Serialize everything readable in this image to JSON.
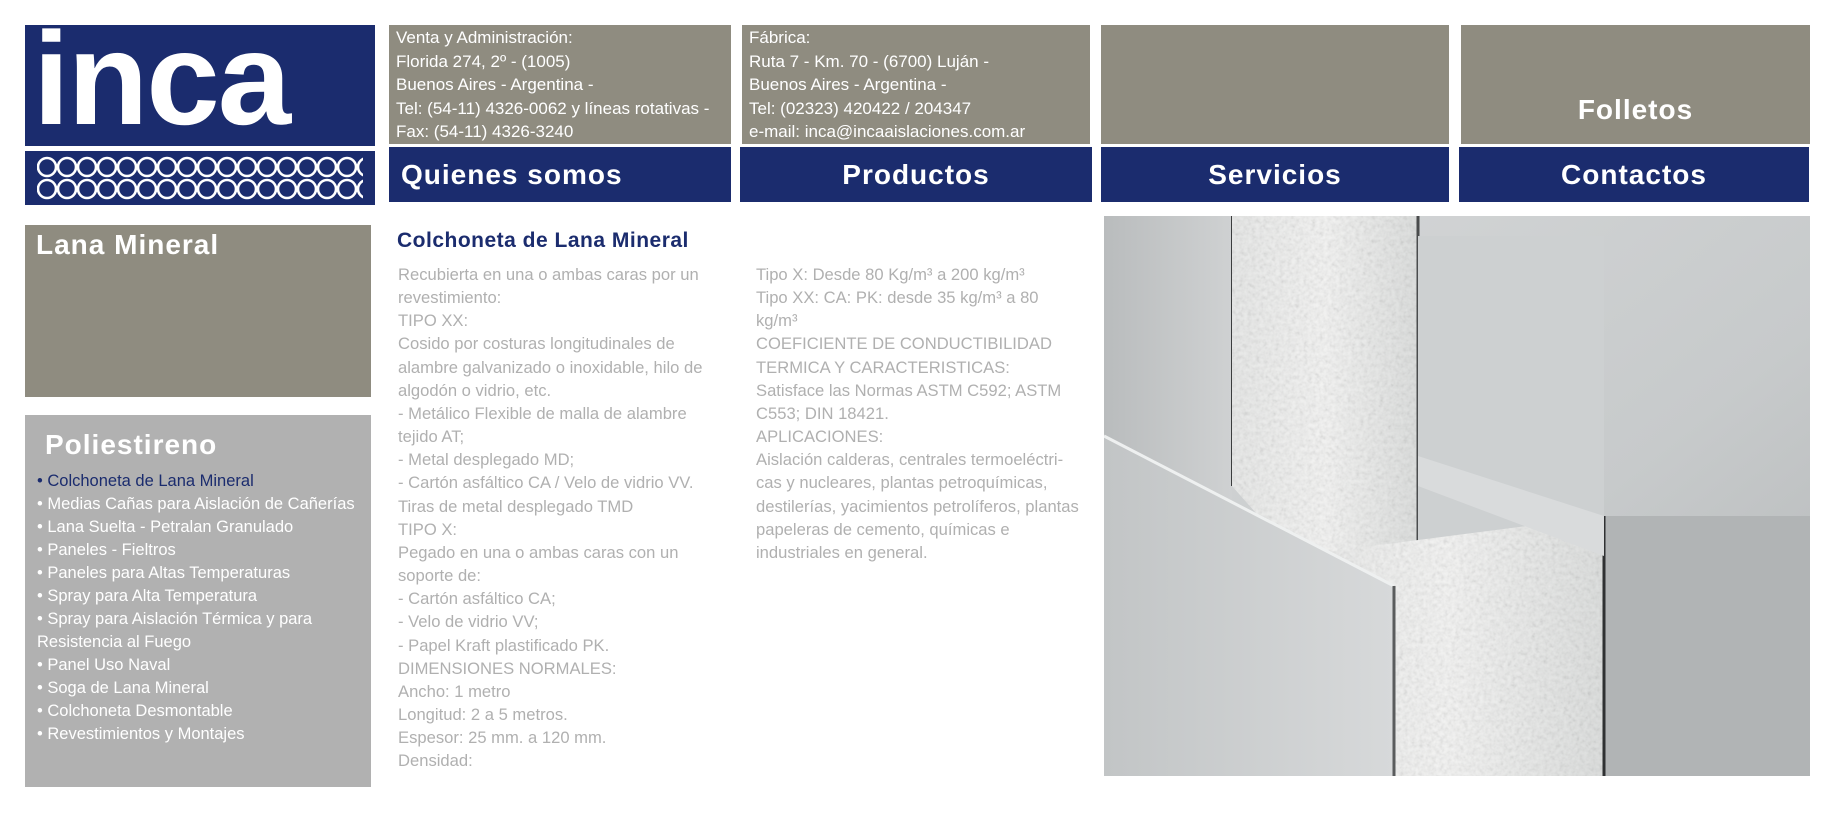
{
  "logo": {
    "text": "inca"
  },
  "header": {
    "venta": {
      "lines": [
        "Venta y Administración:",
        "Florida 274, 2º - (1005)",
        "Buenos Aires - Argentina -",
        "Tel: (54-11) 4326-0062 y líneas rotativas -",
        "Fax: (54-11) 4326-3240"
      ]
    },
    "fabrica": {
      "lines": [
        "Fábrica:",
        "Ruta 7 - Km. 70 - (6700) Luján -",
        "Buenos Aires - Argentina -",
        "Tel: (02323) 420422 / 204347",
        "e-mail: inca@incaaislaciones.com.ar"
      ]
    },
    "folletos_label": "Folletos"
  },
  "nav": {
    "quienes": "Quienes somos",
    "productos": "Productos",
    "servicios": "Servicios",
    "contactos": "Contactos"
  },
  "sidebar": {
    "lana_title": "Lana Mineral",
    "poli_title": "Poliestireno",
    "items": [
      {
        "label": "• Colchoneta de Lana Mineral"
      },
      {
        "label": "• Medias Cañas para Aislación de Cañerías"
      },
      {
        "label": "• Lana Suelta - Petralan Granulado"
      },
      {
        "label": "• Paneles - Fieltros"
      },
      {
        "label": "• Paneles para Altas Temperaturas"
      },
      {
        "label": "• Spray para Alta Temperatura"
      },
      {
        "label": "• Spray para Aislación Térmica y para"
      },
      {
        "label": "Resistencia al Fuego"
      },
      {
        "label": "• Panel Uso Naval"
      },
      {
        "label": "• Soga de Lana Mineral"
      },
      {
        "label": "• Colchoneta Desmontable"
      },
      {
        "label": "• Revestimientos y Montajes"
      }
    ]
  },
  "content": {
    "title": "Colchoneta de Lana Mineral",
    "col1": [
      "Recubierta en una o ambas caras por un",
      "revestimiento:",
      "TIPO XX:",
      "Cosido por costuras longitudinales de",
      "alambre galvanizado o inoxidable, hilo de",
      "algodón o vidrio, etc.",
      "- Metálico Flexible de malla de alambre",
      "tejido AT;",
      "- Metal desplegado MD;",
      "- Cartón asfáltico CA / Velo de vidrio VV.",
      "Tiras de metal desplegado TMD",
      "TIPO X:",
      "Pegado en una o ambas caras con un",
      "soporte de:",
      "- Cartón asfáltico CA;",
      "- Velo de vidrio VV;",
      "- Papel Kraft plastificado PK.",
      "DIMENSIONES NORMALES:",
      "Ancho: 1 metro",
      "Longitud: 2 a 5 metros.",
      "Espesor: 25 mm. a 120 mm.",
      "Densidad:"
    ],
    "col2": [
      "Tipo X: Desde 80 Kg/m³ a 200 kg/m³",
      "Tipo XX: CA: PK: desde 35 kg/m³ a 80",
      "kg/m³",
      "COEFICIENTE DE CONDUCTIBILIDAD",
      "TERMICA Y CARACTERISTICAS:",
      "Satisface las Normas ASTM C592; ASTM",
      "C553; DIN 18421.",
      "APLICACIONES:",
      "Aislación calderas, centrales termoeléctri-",
      "cas y nucleares, plantas petroquímicas,",
      "destilerías, yacimientos petrolíferos, plantas",
      "papeleras de cemento, químicas e",
      "industriales en general."
    ]
  },
  "colors": {
    "navy": "#1b2c6e",
    "gray_box": "#8f8c80",
    "light_panel": "#b1b1b1",
    "body_text": "#b0b0b0"
  }
}
